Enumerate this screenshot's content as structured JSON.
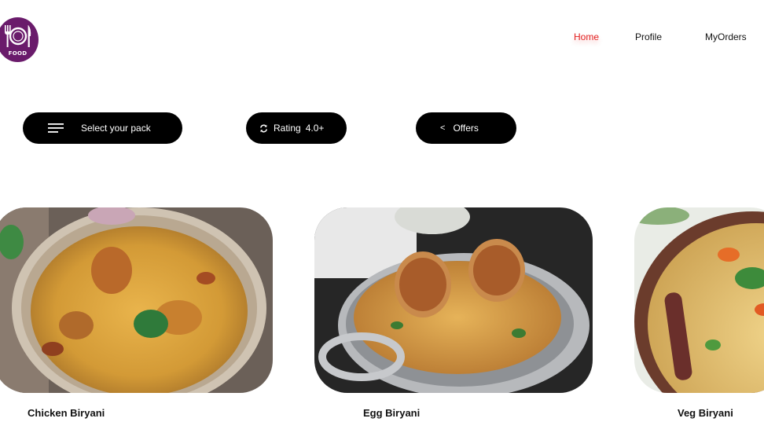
{
  "brand": {
    "logo_text": "FOOD",
    "logo_color": "#6a1b6b"
  },
  "nav": {
    "items": [
      {
        "label": "Home",
        "active": true
      },
      {
        "label": "Profile",
        "active": false
      },
      {
        "label": "MyOrders",
        "active": false
      }
    ],
    "active_color": "#e32020"
  },
  "filters": {
    "pack": {
      "label": "Select your pack",
      "icon": "menu-lines-icon"
    },
    "rating": {
      "label": "Rating",
      "value": "4.0+",
      "icon": "refresh-icon"
    },
    "offers": {
      "label": "Offers",
      "icon": "chevron-left-icon",
      "icon_glyph": "<"
    }
  },
  "dishes": [
    {
      "title": "Chicken Biryani"
    },
    {
      "title": "Egg Biryani"
    },
    {
      "title": "Veg Biryani"
    }
  ]
}
